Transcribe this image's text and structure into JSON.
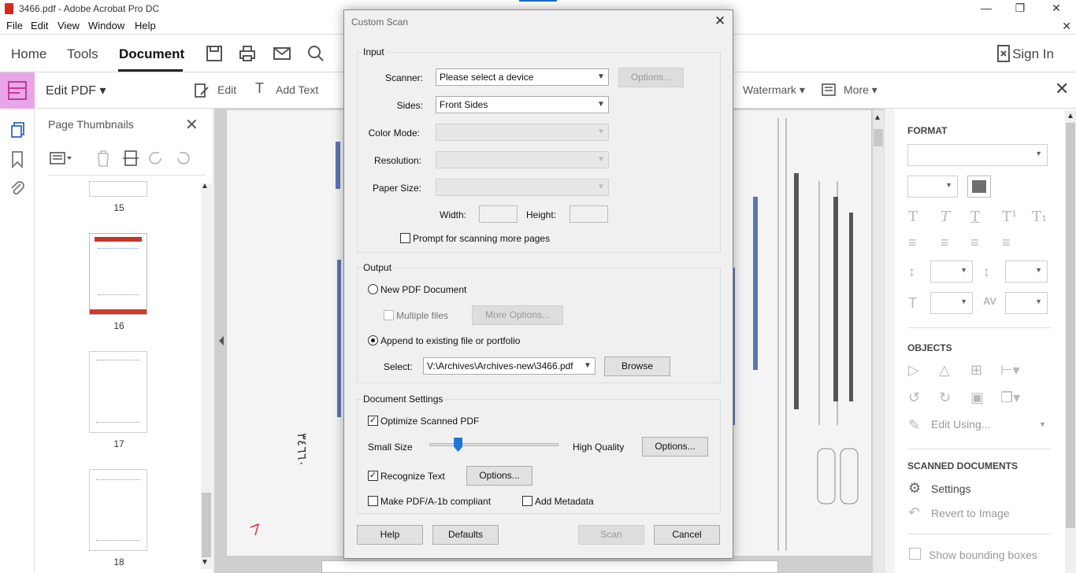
{
  "window": {
    "title": "3466.pdf - Adobe Acrobat Pro DC"
  },
  "menu": [
    "File",
    "Edit",
    "View",
    "Window",
    "Help"
  ],
  "nav": {
    "tabs": [
      "Home",
      "Tools",
      "Document"
    ],
    "sign_in": "Sign In"
  },
  "toolbar": {
    "edit_pdf": "Edit PDF ▾",
    "edit": "Edit",
    "add_text": "Add Text",
    "watermark": "Watermark ▾",
    "more": "More ▾"
  },
  "thumbnails": {
    "title": "Page Thumbnails",
    "pages": [
      "15",
      "16",
      "17",
      "18"
    ]
  },
  "right_panel": {
    "format": "FORMAT",
    "objects": "OBJECTS",
    "edit_using": "Edit Using...",
    "scanned": "SCANNED DOCUMENTS",
    "settings": "Settings",
    "revert": "Revert to Image",
    "bounding": "Show bounding boxes"
  },
  "dialog": {
    "title": "Custom Scan",
    "input": {
      "label": "Input",
      "scanner_label": "Scanner:",
      "scanner_value": "Please select a device",
      "options": "Options...",
      "sides_label": "Sides:",
      "sides_value": "Front Sides",
      "color_label": "Color Mode:",
      "resolution_label": "Resolution:",
      "paper_label": "Paper Size:",
      "width_label": "Width:",
      "height_label": "Height:",
      "prompt": "Prompt for scanning more pages"
    },
    "output": {
      "label": "Output",
      "new_pdf": "New PDF Document",
      "multiple": "Multiple files",
      "more_options": "More Options...",
      "append": "Append to existing file or portfolio",
      "select_label": "Select:",
      "select_value": "V:\\Archives\\Archives-new\\3466.pdf",
      "browse": "Browse"
    },
    "settings": {
      "label": "Document Settings",
      "optimize": "Optimize Scanned PDF",
      "small": "Small Size",
      "high": "High Quality",
      "options": "Options...",
      "quality_level": 0.22,
      "recognize": "Recognize Text",
      "options2": "Options...",
      "pdfa": "Make PDF/A-1b compliant",
      "metadata": "Add Metadata"
    },
    "buttons": {
      "help": "Help",
      "defaults": "Defaults",
      "scan": "Scan",
      "cancel": "Cancel"
    }
  }
}
